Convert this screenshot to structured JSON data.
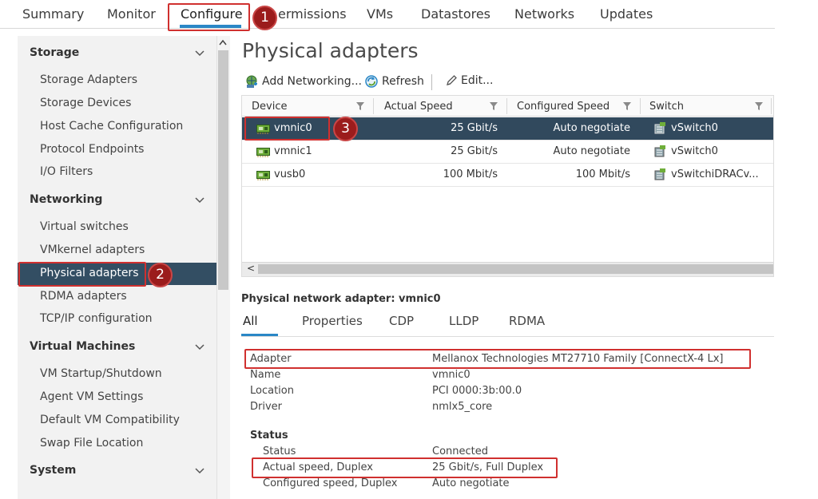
{
  "top_tabs": {
    "summary": "Summary",
    "monitor": "Monitor",
    "configure": "Configure",
    "permissions": "ermissions",
    "vms": "VMs",
    "datastores": "Datastores",
    "networks": "Networks",
    "updates": "Updates"
  },
  "callouts": [
    "1",
    "2",
    "3"
  ],
  "sidebar": {
    "storage": {
      "title": "Storage",
      "items": [
        "Storage Adapters",
        "Storage Devices",
        "Host Cache Configuration",
        "Protocol Endpoints",
        "I/O Filters"
      ]
    },
    "networking": {
      "title": "Networking",
      "items": [
        "Virtual switches",
        "VMkernel adapters",
        "Physical adapters",
        "RDMA adapters",
        "TCP/IP configuration"
      ]
    },
    "virtual_machines": {
      "title": "Virtual Machines",
      "items": [
        "VM Startup/Shutdown",
        "Agent VM Settings",
        "Default VM Compatibility",
        "Swap File Location"
      ]
    },
    "system": {
      "title": "System"
    }
  },
  "main": {
    "title": "Physical adapters",
    "toolbar": {
      "add_networking": "Add Networking...",
      "refresh": "Refresh",
      "edit": "Edit..."
    },
    "grid": {
      "columns": [
        "Device",
        "Actual Speed",
        "Configured Speed",
        "Switch"
      ],
      "rows": [
        {
          "device": "vmnic0",
          "actual": "25 Gbit/s",
          "configured": "Auto negotiate",
          "switch": "vSwitch0",
          "selected": true
        },
        {
          "device": "vmnic1",
          "actual": "25 Gbit/s",
          "configured": "Auto negotiate",
          "switch": "vSwitch0",
          "selected": false
        },
        {
          "device": "vusb0",
          "actual": "100 Mbit/s",
          "configured": "100 Mbit/s",
          "switch": "vSwitchiDRACv...",
          "selected": false
        }
      ],
      "scroll_left": "<"
    },
    "detail": {
      "title": "Physical network adapter: vmnic0",
      "tabs": [
        "All",
        "Properties",
        "CDP",
        "LLDP",
        "RDMA"
      ],
      "props": [
        {
          "k": "Adapter",
          "v": "Mellanox Technologies MT27710 Family [ConnectX-4 Lx]"
        },
        {
          "k": "Name",
          "v": "vmnic0"
        },
        {
          "k": "Location",
          "v": "PCI 0000:3b:00.0"
        },
        {
          "k": "Driver",
          "v": "nmlx5_core"
        }
      ],
      "status_header": "Status",
      "status": [
        {
          "k": "Status",
          "v": "Connected"
        },
        {
          "k": "Actual speed, Duplex",
          "v": "25 Gbit/s, Full Duplex"
        },
        {
          "k": "Configured speed, Duplex",
          "v": "Auto negotiate"
        }
      ]
    }
  },
  "colors": {
    "accent": "#2a87c6",
    "selected_row": "#31495d",
    "sidebar_active": "#334e63",
    "callout_red": "#d0302f",
    "badge_fill": "#9b1c1c"
  },
  "icons": {
    "filter": "filter-icon",
    "nic": "network-card-icon",
    "switch": "virtual-switch-icon",
    "add": "add-networking-icon",
    "refresh": "refresh-icon",
    "edit": "pencil-icon",
    "chevron": "chevron-down-icon"
  }
}
